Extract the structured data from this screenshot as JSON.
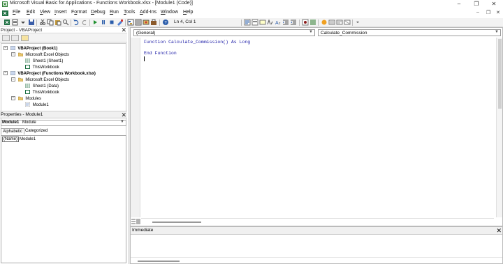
{
  "window": {
    "title": "Microsoft Visual Basic for Applications - Functions Workbook.xlsx - [Module1 (Code)]",
    "minimize": "–",
    "restore": "❐",
    "close": "✕"
  },
  "menu": {
    "items": [
      {
        "pre": "",
        "u": "F",
        "post": "ile"
      },
      {
        "pre": "",
        "u": "E",
        "post": "dit"
      },
      {
        "pre": "",
        "u": "V",
        "post": "iew"
      },
      {
        "pre": "",
        "u": "I",
        "post": "nsert"
      },
      {
        "pre": "F",
        "u": "o",
        "post": "rmat"
      },
      {
        "pre": "",
        "u": "D",
        "post": "ebug"
      },
      {
        "pre": "",
        "u": "R",
        "post": "un"
      },
      {
        "pre": "",
        "u": "T",
        "post": "ools"
      },
      {
        "pre": "",
        "u": "A",
        "post": "dd-Ins"
      },
      {
        "pre": "",
        "u": "W",
        "post": "indow"
      },
      {
        "pre": "",
        "u": "H",
        "post": "elp"
      }
    ],
    "mdi_minimize": "–",
    "mdi_restore": "❐",
    "mdi_close": "✕"
  },
  "toolbar": {
    "position_text": "Ln 4, Col 1"
  },
  "project": {
    "title": "Project - VBAProject",
    "close": "✕",
    "nodes": [
      {
        "label": "VBAProject (Book1)",
        "bold": true,
        "expander": "−",
        "icon": "project"
      },
      {
        "label": "Microsoft Excel Objects",
        "bold": false,
        "expander": "−",
        "icon": "folder"
      },
      {
        "label": "Sheet1 (Sheet1)",
        "bold": false,
        "expander": "",
        "icon": "sheet"
      },
      {
        "label": "ThisWorkbook",
        "bold": false,
        "expander": "",
        "icon": "workbook"
      },
      {
        "label": "VBAProject (Functions Workbook.xlsx)",
        "bold": true,
        "expander": "−",
        "icon": "project"
      },
      {
        "label": "Microsoft Excel Objects",
        "bold": false,
        "expander": "−",
        "icon": "folder"
      },
      {
        "label": "Sheet1 (Data)",
        "bold": false,
        "expander": "",
        "icon": "sheet"
      },
      {
        "label": "ThisWorkbook",
        "bold": false,
        "expander": "",
        "icon": "workbook"
      },
      {
        "label": "Modules",
        "bold": false,
        "expander": "−",
        "icon": "folder"
      },
      {
        "label": "Module1",
        "bold": false,
        "expander": "",
        "icon": "module"
      }
    ]
  },
  "properties": {
    "title": "Properties - Module1",
    "close": "✕",
    "object_name": "Module1",
    "object_type": "Module",
    "tabs": [
      "Alphabetic",
      "Categorized"
    ],
    "rows": [
      {
        "key": "(Name)",
        "value": "Module1"
      }
    ]
  },
  "code": {
    "object_dropdown": "(General)",
    "procedure_dropdown": "Calculate_Commission",
    "lines": [
      "Function Calculate_Commission() As Long",
      "",
      "End Function",
      ""
    ]
  },
  "immediate": {
    "title": "Immediate",
    "close": "✕"
  }
}
